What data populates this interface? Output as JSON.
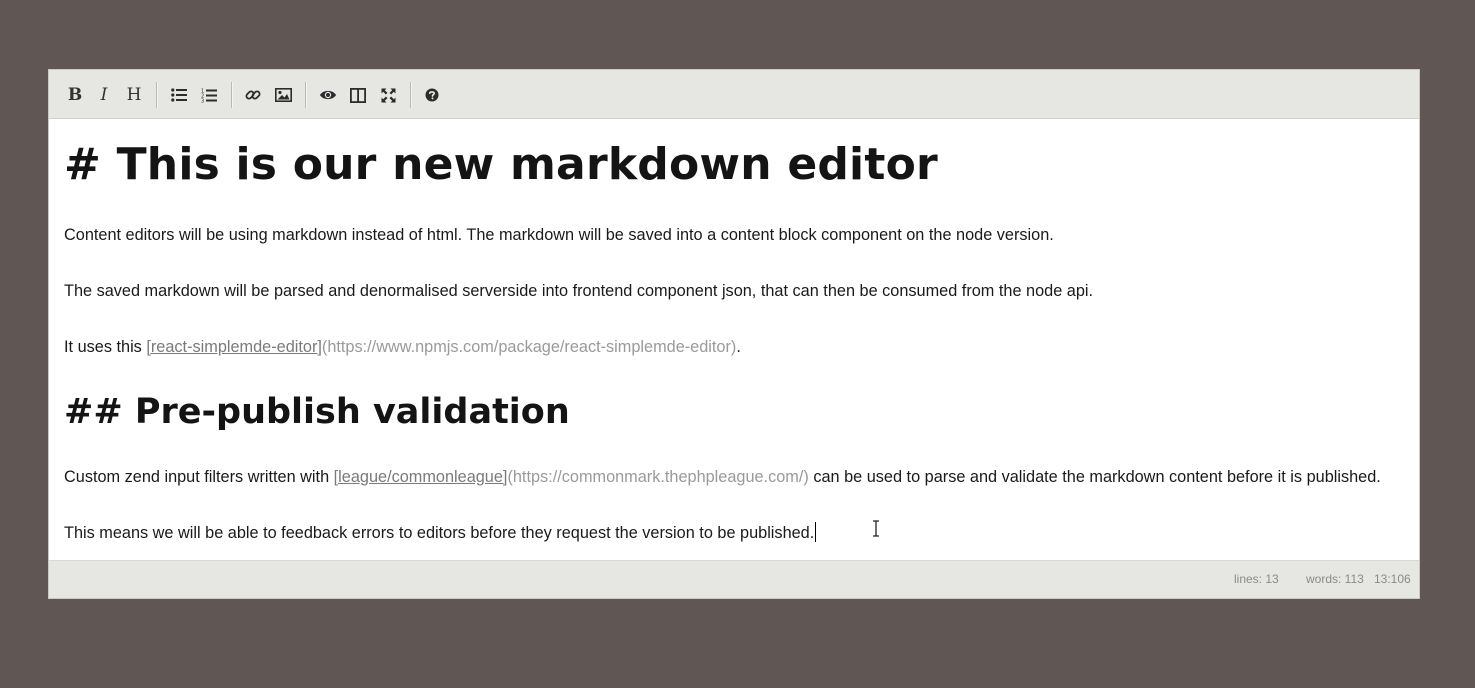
{
  "toolbar": {
    "bold_label": "B",
    "italic_label": "I",
    "heading_label": "H",
    "buttons": [
      {
        "name": "bold-button",
        "icon": "bold-icon"
      },
      {
        "name": "italic-button",
        "icon": "italic-icon"
      },
      {
        "name": "heading-button",
        "icon": "heading-icon"
      },
      {
        "name": "unordered-list-button",
        "icon": "list-ul-icon"
      },
      {
        "name": "ordered-list-button",
        "icon": "list-ol-icon"
      },
      {
        "name": "link-button",
        "icon": "link-icon"
      },
      {
        "name": "image-button",
        "icon": "image-icon"
      },
      {
        "name": "preview-button",
        "icon": "eye-icon"
      },
      {
        "name": "side-by-side-button",
        "icon": "columns-icon"
      },
      {
        "name": "fullscreen-button",
        "icon": "fullscreen-icon"
      },
      {
        "name": "guide-button",
        "icon": "question-circle-icon"
      }
    ]
  },
  "content": {
    "heading1": "# This is our new markdown editor",
    "paragraph1": "Content editors will be using markdown instead of html. The markdown will be saved into a content block component on the node version.",
    "paragraph2": "The saved markdown will be parsed and denormalised serverside into frontend component json, that can then be consumed from the node api.",
    "paragraph3": {
      "prefix": "It uses this ",
      "link_text": "[react-simplemde-editor]",
      "link_url": "(https://www.npmjs.com/package/react-simplemde-editor)",
      "suffix": "."
    },
    "heading2": "## Pre-publish validation",
    "paragraph4": {
      "prefix": "Custom zend input filters written with ",
      "link_text": "[league/commonleague]",
      "link_url": "(https://commonmark.thephpleague.com/)",
      "suffix": " can be used to parse and validate the markdown content before it is published."
    },
    "paragraph5": "This means we will be able to feedback errors to editors before they request the version to be published."
  },
  "statusbar": {
    "lines": "lines: 13",
    "words": "words: 113",
    "cursor": "13:106"
  },
  "colors": {
    "background": "#605755",
    "toolbar": "#e6e6e3",
    "link_text": "#7a7a7a",
    "link_url": "#9a9a9a"
  }
}
